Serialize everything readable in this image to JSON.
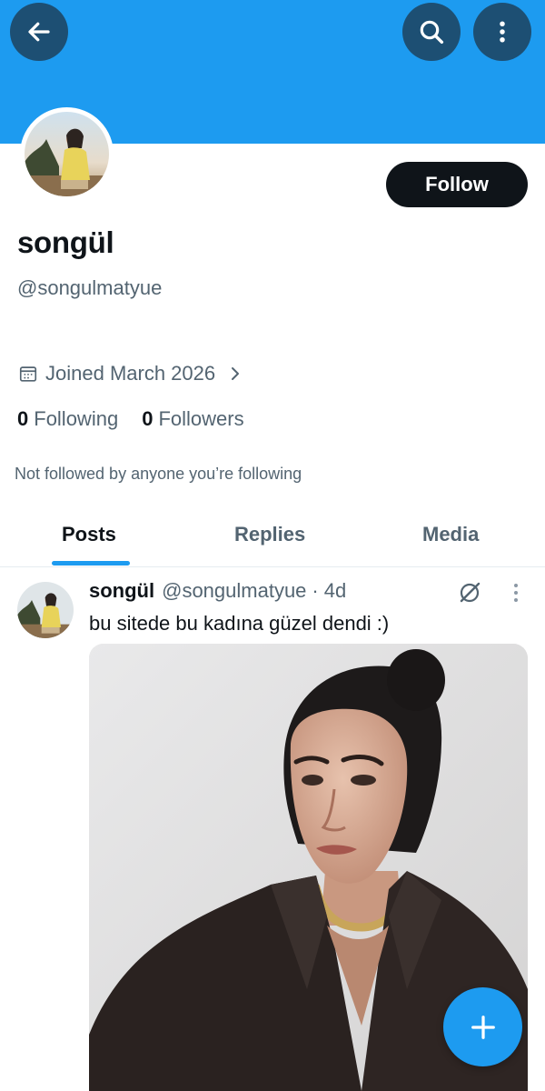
{
  "colors": {
    "banner": "#1d9bf0",
    "header_button": "#1d4f73",
    "accent": "#1d9bf0",
    "text_primary": "#0f1419",
    "text_secondary": "#536471",
    "follow_button": "#0f1419"
  },
  "header": {
    "back_icon": "arrow-left-icon",
    "search_icon": "search-icon",
    "more_icon": "more-vertical-icon"
  },
  "profile": {
    "display_name": "songül",
    "handle": "@songulmatyue",
    "follow_label": "Follow",
    "joined": "Joined March 2026",
    "following_count": "0",
    "following_label": "Following",
    "followers_count": "0",
    "followers_label": "Followers",
    "not_followed_note": "Not followed by anyone you’re following"
  },
  "tabs": [
    {
      "label": "Posts",
      "active": true
    },
    {
      "label": "Replies",
      "active": false
    },
    {
      "label": "Media",
      "active": false
    }
  ],
  "post": {
    "author_name": "songül",
    "author_handle": "@songulmatyue",
    "separator": "·",
    "time": "4d",
    "text": "bu sitede bu kadına güzel dendi :)",
    "grok_icon": "grok-icon",
    "more_icon": "more-vertical-icon"
  },
  "fab": {
    "icon": "plus-icon"
  }
}
